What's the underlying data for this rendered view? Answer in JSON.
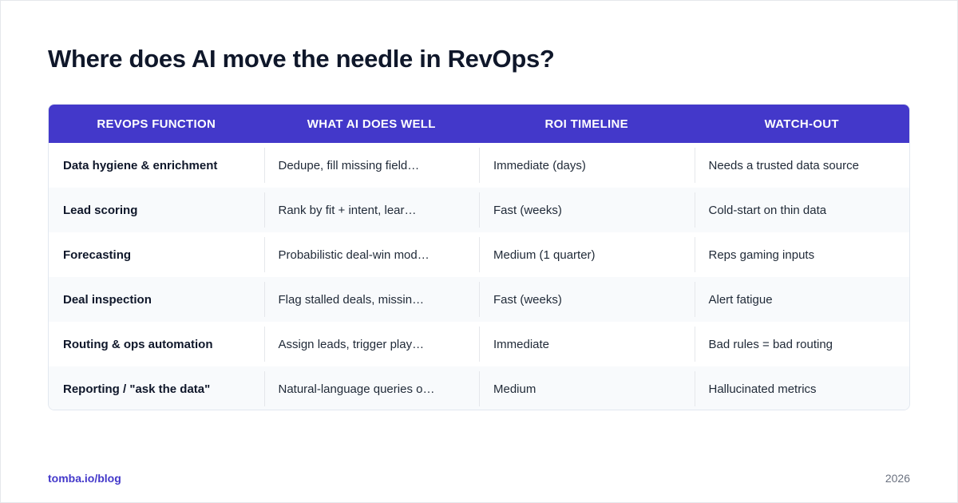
{
  "title": "Where does AI move the needle in RevOps?",
  "colors": {
    "header_bg": "#4338ca",
    "row_alt_bg": "#f8fafc",
    "link": "#4338ca"
  },
  "table": {
    "headers": [
      "REVOPS FUNCTION",
      "WHAT AI DOES WELL",
      "ROI TIMELINE",
      "WATCH-OUT"
    ],
    "rows": [
      [
        "Data hygiene & enrichment",
        "Dedupe, fill missing field…",
        "Immediate (days)",
        "Needs a trusted data source"
      ],
      [
        "Lead scoring",
        "Rank by fit + intent, lear…",
        "Fast (weeks)",
        "Cold-start on thin data"
      ],
      [
        "Forecasting",
        "Probabilistic deal-win mod…",
        "Medium (1 quarter)",
        "Reps gaming inputs"
      ],
      [
        "Deal inspection",
        "Flag stalled deals, missin…",
        "Fast (weeks)",
        "Alert fatigue"
      ],
      [
        "Routing & ops automation",
        "Assign leads, trigger play…",
        "Immediate",
        "Bad rules = bad routing"
      ],
      [
        "Reporting / \"ask the data\"",
        "Natural-language queries o…",
        "Medium",
        "Hallucinated metrics"
      ]
    ]
  },
  "footer": {
    "link": "tomba.io/blog",
    "year": "2026"
  }
}
